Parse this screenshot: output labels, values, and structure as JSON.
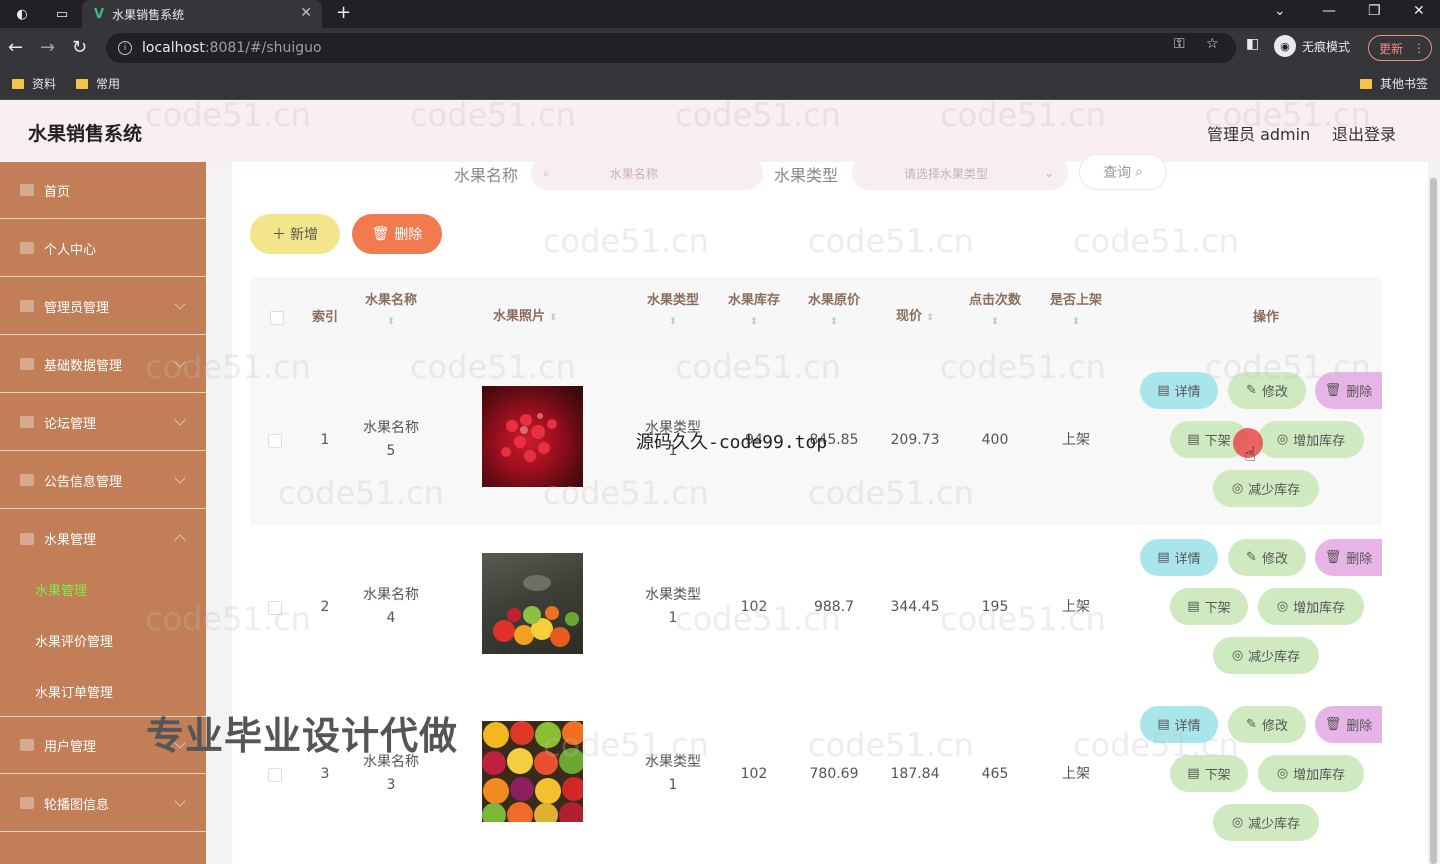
{
  "browser": {
    "tab_title": "水果销售系统",
    "url_host": "localhost",
    "url_rest": ":8081/#/shuiguo",
    "incognito_label": "无痕模式",
    "update_label": "更新",
    "bookmarks": [
      "资料",
      "常用"
    ],
    "other_bookmarks": "其他书签"
  },
  "header": {
    "title": "水果销售系统",
    "user": "管理员 admin",
    "logout": "退出登录"
  },
  "sidebar": {
    "items": [
      "首页",
      "个人中心",
      "管理员管理",
      "基础数据管理",
      "论坛管理",
      "公告信息管理",
      "水果管理",
      "用户管理",
      "轮播图信息"
    ],
    "fruit_submenu": [
      "水果管理",
      "水果评价管理",
      "水果订单管理"
    ]
  },
  "search": {
    "name_label": "水果名称",
    "name_placeholder": "水果名称",
    "type_label": "水果类型",
    "type_placeholder": "请选择水果类型",
    "query_button": "查询"
  },
  "toolbar": {
    "add": "新增",
    "delete": "删除"
  },
  "table": {
    "headers": {
      "index": "索引",
      "name": "水果名称",
      "photo": "水果照片",
      "type": "水果类型",
      "stock": "水果库存",
      "orig_price": "水果原价",
      "price": "现价",
      "clicks": "点击次数",
      "listed": "是否上架",
      "ops": "操作"
    },
    "rows": [
      {
        "index": "1",
        "name1": "水果名称",
        "name2": "5",
        "type1": "水果类型",
        "type2": "1",
        "stock": "94",
        "orig_price": "845.85",
        "price": "209.73",
        "clicks": "400",
        "listed": "上架"
      },
      {
        "index": "2",
        "name1": "水果名称",
        "name2": "4",
        "type1": "水果类型",
        "type2": "1",
        "stock": "102",
        "orig_price": "988.7",
        "price": "344.45",
        "clicks": "195",
        "listed": "上架"
      },
      {
        "index": "3",
        "name1": "水果名称",
        "name2": "3",
        "type1": "水果类型",
        "type2": "1",
        "stock": "102",
        "orig_price": "780.69",
        "price": "187.84",
        "clicks": "465",
        "listed": "上架"
      }
    ],
    "ops": {
      "detail": "详情",
      "edit": "修改",
      "delete": "删除",
      "down": "下架",
      "add_stock": "增加库存",
      "reduce_stock": "减少库存"
    }
  },
  "overlays": {
    "source_text": "源码久久-code99.top",
    "banner": "专业毕业设计代做",
    "watermark": "code51.cn"
  }
}
